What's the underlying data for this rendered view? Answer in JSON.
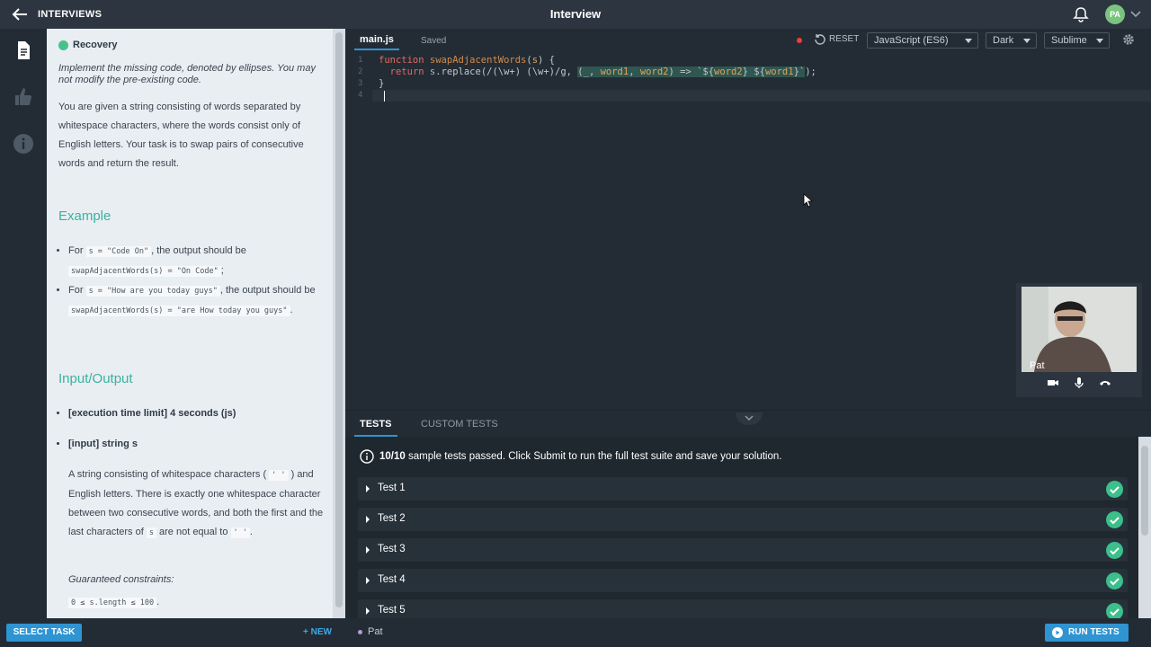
{
  "topbar": {
    "brand": "INTERVIEWS",
    "title": "Interview",
    "avatar": "PA"
  },
  "task": {
    "title": "Recovery",
    "intro": "Implement the missing code, denoted by ellipses. You may not modify the pre-existing code.",
    "body": "You are given a string consisting of words separated by whitespace characters, where the words consist only of English letters. Your task is to swap pairs of consecutive words and return the result.",
    "example_heading": "Example",
    "ex1_pre": "For ",
    "ex1_code": "s = \"Code On\"",
    "ex1_mid": ", the output should be",
    "ex1_result": "swapAdjacentWords(s) = \"On Code\"",
    "ex1_end": ";",
    "ex2_pre": "For ",
    "ex2_code": "s = \"How are you today guys\"",
    "ex2_mid": ", the output should be",
    "ex2_result": "swapAdjacentWords(s) = \"are How today you guys\"",
    "ex2_end": ".",
    "io_heading": "Input/Output",
    "exec_limit": "[execution time limit] 4 seconds (js)",
    "input": "[input] string s",
    "desc_a": "A string consisting of whitespace characters (",
    "desc_code1": "' '",
    "desc_b": ") and English letters. There is exactly one whitespace character between two consecutive words, and both the first and the last characters of",
    "desc_code2": "s",
    "desc_c": "are not equal to",
    "desc_code3": "' '",
    "desc_d": ".",
    "constraints_label": "Guaranteed constraints:",
    "constraint": "0 ≤ s.length ≤ 100",
    "constraint_end": "."
  },
  "bottom": {
    "select_task": "SELECT TASK",
    "new": "+ NEW",
    "user": "Pat",
    "run_tests": "RUN TESTS"
  },
  "editor": {
    "file": "main.js",
    "status": "Saved",
    "reset": "RESET",
    "language": "JavaScript (ES6)",
    "theme": "Dark",
    "keymap": "Sublime",
    "line_numbers": [
      "1",
      "2",
      "3",
      "4"
    ]
  },
  "video": {
    "name": "Pat"
  },
  "tests": {
    "tab_tests": "TESTS",
    "tab_custom": "CUSTOM TESTS",
    "summary_bold": "10/10",
    "summary_text": "sample tests passed. Click Submit to run the full test suite and save your solution.",
    "items": [
      "Test 1",
      "Test 2",
      "Test 3",
      "Test 4",
      "Test 5"
    ]
  },
  "colors": {
    "accent": "#2f94d2",
    "success": "#3cbf8a",
    "heading": "#3ab2a0"
  }
}
